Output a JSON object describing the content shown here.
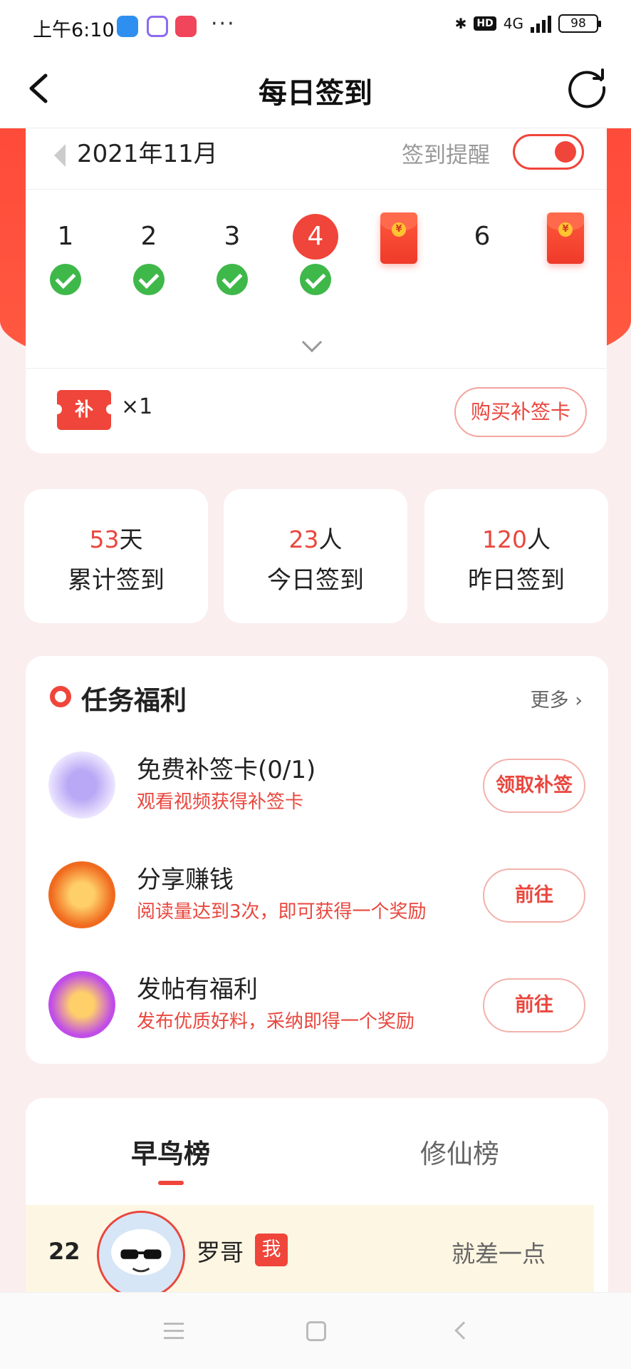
{
  "status": {
    "time": "上午6:10",
    "hd": "HD",
    "network": "4G",
    "battery": "98"
  },
  "header": {
    "title": "每日签到"
  },
  "calendar": {
    "month": "2021年11月",
    "remind_label": "签到提醒",
    "remind_on": true,
    "days": [
      {
        "label": "1",
        "checked": true
      },
      {
        "label": "2",
        "checked": true
      },
      {
        "label": "3",
        "checked": true
      },
      {
        "label": "4",
        "checked": true,
        "today": true
      },
      {
        "label": "",
        "reward": true
      },
      {
        "label": "6",
        "checked": false
      },
      {
        "label": "",
        "reward": true
      }
    ],
    "ticket_icon_text": "补",
    "ticket_count": "×1",
    "buy_button": "购买补签卡"
  },
  "stats": [
    {
      "value": "53",
      "unit": "天",
      "label": "累计签到"
    },
    {
      "value": "23",
      "unit": "人",
      "label": "今日签到"
    },
    {
      "value": "120",
      "unit": "人",
      "label": "昨日签到"
    }
  ],
  "tasks": {
    "title": "任务福利",
    "more": "更多",
    "items": [
      {
        "name": "免费补签卡(0/1)",
        "desc": "观看视频获得补签卡",
        "button": "领取补签"
      },
      {
        "name": "分享赚钱",
        "desc": "阅读量达到3次，即可获得一个奖励",
        "button": "前往"
      },
      {
        "name": "发帖有福利",
        "desc": "发布优质好料，采纳即得一个奖励",
        "button": "前往"
      }
    ]
  },
  "leaderboard": {
    "tabs": [
      "早鸟榜",
      "修仙榜"
    ],
    "row": {
      "rank": "22",
      "name": "罗哥",
      "badge": "我",
      "status": "就差一点"
    }
  },
  "colors": {
    "accent": "#f0453a",
    "check": "#3fb84a",
    "bg": "#fbeeee"
  }
}
